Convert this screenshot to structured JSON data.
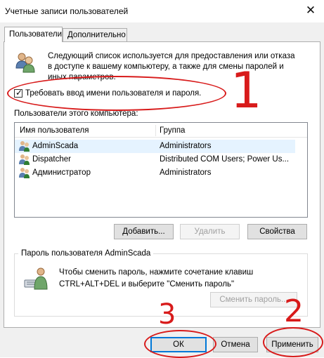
{
  "window": {
    "title": "Учетные записи пользователей",
    "close_glyph": "✕"
  },
  "tabs": [
    {
      "label": "Пользователи",
      "active": true
    },
    {
      "label": "Дополнительно",
      "active": false
    }
  ],
  "intro_text": [
    "Следующий список используется для предоставления или отказа",
    "в доступе к вашему компьютеру, а также для смены паролей и",
    "иных параметров."
  ],
  "require_login": {
    "label": "Требовать ввод имени пользователя и пароля.",
    "checked": true
  },
  "users_section_label": "Пользователи этого компьютера:",
  "users_table": {
    "columns": [
      "Имя пользователя",
      "Группа"
    ],
    "rows": [
      {
        "name": "AdminScada",
        "group": "Administrators",
        "selected": true
      },
      {
        "name": "Dispatcher",
        "group": "Distributed COM Users; Power Us...",
        "selected": false
      },
      {
        "name": "Администратор",
        "group": "Administrators",
        "selected": false
      }
    ]
  },
  "user_buttons": {
    "add": "Добавить...",
    "remove": "Удалить",
    "properties": "Свойства"
  },
  "password_group": {
    "title": "Пароль пользователя AdminScada",
    "text_line1": "Чтобы сменить пароль, нажмите сочетание клавиш",
    "text_line2": "CTRL+ALT+DEL и выберите \"Сменить пароль\"",
    "change_button": "Сменить пароль..."
  },
  "dialog_buttons": {
    "ok": "ОК",
    "cancel": "Отмена",
    "apply": "Применить"
  },
  "annotations": {
    "one": "1",
    "two": "2",
    "three": "3",
    "color": "#d81b1b"
  },
  "icons": [
    "users-icon",
    "user-icon",
    "keyboard-user-icon",
    "close-icon"
  ]
}
